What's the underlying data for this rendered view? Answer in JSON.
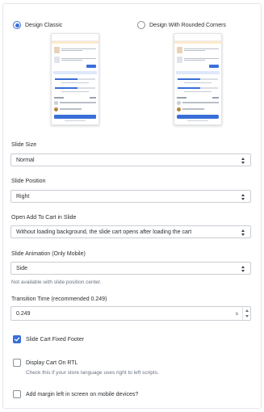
{
  "design": {
    "options": [
      {
        "label": "Design Classic",
        "selected": true
      },
      {
        "label": "Design With Rounded Corners",
        "selected": false
      }
    ]
  },
  "slide_size": {
    "label": "Slide Size",
    "value": "Normal"
  },
  "slide_position": {
    "label": "Slide Position",
    "value": "Right"
  },
  "open_add_to_cart": {
    "label": "Open Add To Cart in Slide",
    "value": "Without loading background, the slide cart opens after loading the cart"
  },
  "slide_animation": {
    "label": "Slide Animation (Only Mobile)",
    "value": "Side",
    "help": "Not available with slide position center."
  },
  "transition_time": {
    "label": "Transition Time (recommended 0.249)",
    "value": "0.249",
    "unit": "s"
  },
  "fixed_footer": {
    "label": "Slide Cart Fixed Footer",
    "checked": true
  },
  "display_rtl": {
    "label": "Display Cart On RTL",
    "checked": false,
    "help": "Check this if your store language uses right to left scripts."
  },
  "margin_left": {
    "label": "Add margin left in screen on mobile devices?",
    "checked": false
  },
  "colors": {
    "accent": "#3a6fd8",
    "border": "#c9cdd3",
    "text": "#2c2f33",
    "muted": "#6b7280"
  }
}
